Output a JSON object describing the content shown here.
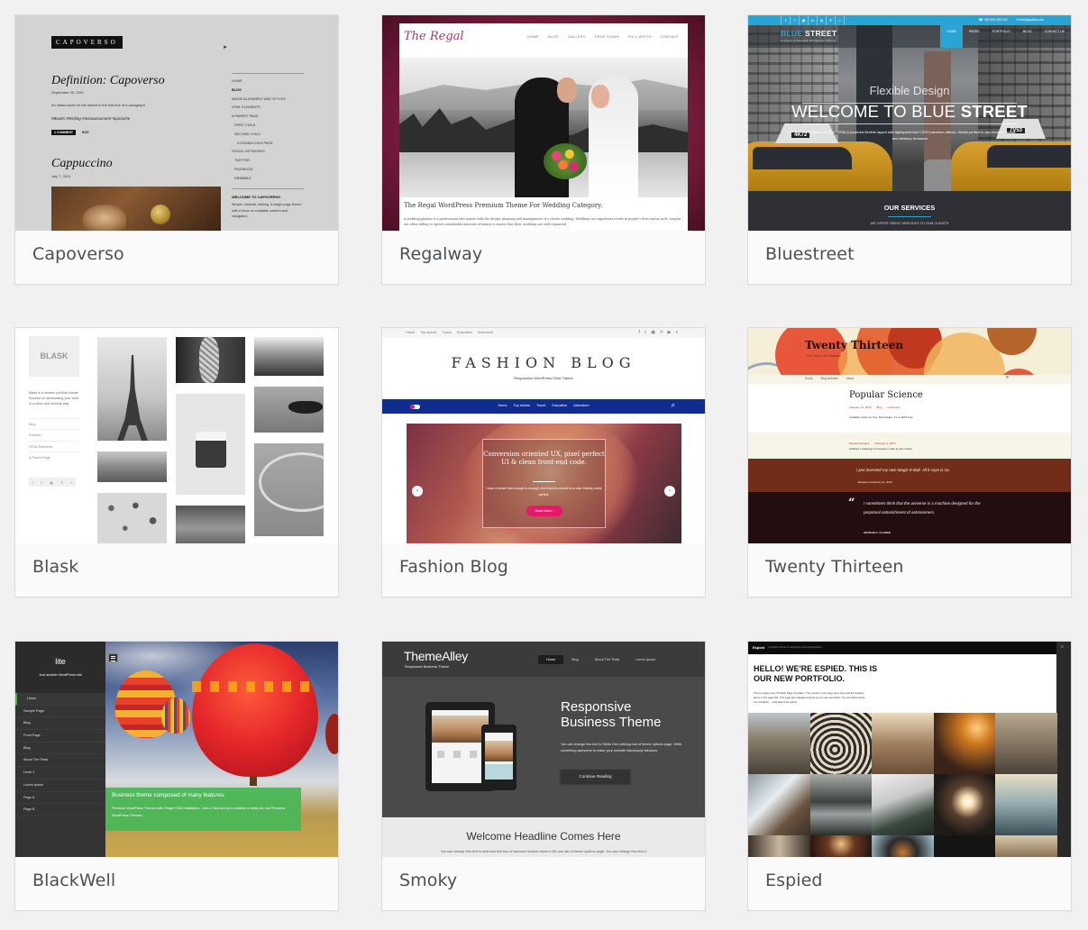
{
  "page": {
    "background": "#f1f1f1"
  },
  "themes": [
    {
      "name": "Capoverso",
      "preview": {
        "logo": "CAPOVERSO",
        "post1_title": "Definition: Capoverso",
        "post1_date": "September 20, 2011",
        "post1_text": "An Italian word for the indent in the first line of a paragraph.",
        "post1_tags": "#Books  #Writing  #announcement  #panache",
        "post1_comment_button": "1 COMMENT",
        "post1_edit": "EDIT",
        "post2_title": "Cappuccino",
        "post2_date": "July 7, 2011",
        "sidebar_menu": [
          "HOME",
          "BLOG",
          "IMAGE ALIGNMENT AND STYLES",
          "HTML ELEMENTS",
          "A PARENT PAGE",
          "FIRST CHILD",
          "SECOND CHILD",
          "A GRANDCHILD PAGE",
          "SOCIAL NETWORKS",
          "TWITTER",
          "FACEBOOK",
          "DRIBBBLE"
        ],
        "widget_title": "WELCOME TO CAPOVERSO",
        "widget_text": "Simple, minimal, striking. A single-page theme with a focus on readable content and navigation."
      }
    },
    {
      "name": "Regalway",
      "preview": {
        "logo": "The Regal",
        "nav": [
          "HOME",
          "BLOG",
          "GALLERY",
          "DROP DOWN",
          "FULL WIDTH",
          "CONTACT"
        ],
        "headline": "The Regal WordPress Premium Theme For Wedding Category.",
        "body": "A wedding planner is a professional who assists with the design, planning and management of a clients wedding. Weddings are significant events in people's lives and as such, couples are often willing to spend considerable amounts of money to ensure that their weddings are well-organized.",
        "accent_color": "#7a1c40"
      }
    },
    {
      "name": "Bluestreet",
      "preview": {
        "social_icons": [
          "twitter-icon",
          "facebook-icon",
          "instagram-icon",
          "linkedin-icon",
          "dribbble-icon",
          "pinterest-icon",
          "rss-icon"
        ],
        "phone": "+48 000 456 120",
        "email": "info@quality.com",
        "logo_part1": "BLUE",
        "logo_part2": "STREET",
        "logo_tagline": "Creative & Flexible Wordpress Theme",
        "nav": [
          "HOME",
          "PAGES",
          "PORTFOLIO",
          "BLOG",
          "CONTACT US"
        ],
        "hero_subtitle": "Flexible Design",
        "hero_title_light": "WELCOME TO BLUE ",
        "hero_title_bold": "STREET",
        "hero_text": "The state-of-the-art HTML5 powered flexible layout with lightspeed fast CSS3 transition effects. Works perfect in any modern mobile and desktop browsers.",
        "taxi_sign_left": "4K72",
        "taxi_sign_right": "7V53",
        "services_title": "OUR SERVICES",
        "services_text": "WE OFFER GREAT SERVICES TO OUR CLIENTS",
        "accent_color": "#2aa5d3"
      }
    },
    {
      "name": "Blask",
      "preview": {
        "logo": "BLASK",
        "description": "Blask is a modern portfolio theme focused on showcasing your work in a clean and minimal way.",
        "menu": [
          "Blog",
          "Portfolio",
          "HTML Elements",
          "A Parent Page"
        ],
        "social_icons": [
          "facebook-icon",
          "twitter-icon",
          "instagram-icon",
          "pinterest-icon",
          "vimeo-icon"
        ]
      }
    },
    {
      "name": "Fashion Blog",
      "preview": {
        "top_links": [
          "Home",
          "Top stories",
          "Travel",
          "Education",
          "Adventure"
        ],
        "social_icons": [
          "facebook-icon",
          "twitter-icon",
          "instagram-icon",
          "pinterest-icon",
          "youtube-icon",
          "vimeo-icon"
        ],
        "title": "FASHION BLOG",
        "tagline": "Responsive WordPress Child Theme",
        "nav": [
          "Home",
          "Top stories",
          "Travel",
          "Education",
          "Adventure"
        ],
        "slide_title": "Conversion oriented UX, pixel perfect UI & clean front-end code.",
        "slide_text": "I have a dream that enough is enough. And that this should be a user friendly world, perfect.",
        "slide_button": "Read More ›",
        "nav_color": "#0e2d8e",
        "accent_color": "#e6186a"
      }
    },
    {
      "name": "Twenty Thirteen",
      "preview": {
        "title": "Twenty Thirteen",
        "tagline": "The Future is Fantastic",
        "nav": [
          "Home",
          "Blog archives",
          "About"
        ],
        "post_title": "Popular Science",
        "post_meta": [
          "February 12, 2013",
          "Blog",
          "wordpress"
        ],
        "post_text": "Available online for free. But beware, it's a rabbit hole.",
        "aside_meta": [
          "Monsters Engine",
          "February 4, 2013"
        ],
        "aside_text": "Children's drawings of monsters made by box robots.",
        "status_text": "I just invented my own Magic 8-Ball. All it says is no.",
        "status_author": "Benjamin February 11, 2013",
        "quote_text": "I sometimes think that the universe is a machine designed for the perpetual astonishment of astronomers.",
        "quote_author": "ARTHUR C. CLARKE"
      }
    },
    {
      "name": "BlackWell",
      "preview": {
        "site_title": "lite",
        "site_tagline": "Just another WordPress site",
        "menu": [
          "Home",
          "Sample Page",
          "Blog",
          "Front Page",
          "Blog",
          "About The Tests",
          "Level 1",
          "Lorem Ipsum",
          "Page A",
          "Page B"
        ],
        "active_menu_index": 0,
        "banner_title": "Business theme composed of many features.",
        "banner_text": "Premium WordPress Themes with Single Click Installation, Just a Click and your website is ready for use Premium WordPress Themes.",
        "accent_color": "#4caf50"
      }
    },
    {
      "name": "Smoky",
      "preview": {
        "logo": "ThemeAlley",
        "tagline": "Responsive Business Theme",
        "nav": [
          "Home",
          "Blog",
          "About The Tests",
          "Lorem Ipsum"
        ],
        "active_nav_index": 0,
        "hero_title": "Responsive Business Theme",
        "hero_text": "You can change this text in Slider One settings tab of theme options page. Write something awesome to make your website ridiculously fabulous.",
        "hero_button": "Continue Reading",
        "welcome_title": "Welcome Headline Comes Here",
        "welcome_text": "You can change this text in welcome text box of welcome section block in Biz one tab of theme options page. You can change this text in"
      }
    },
    {
      "name": "Espied",
      "preview": {
        "site_title": "Espied",
        "site_tagline": "A portfolio theme for designers and photographers",
        "headline": "HELLO! WE'RE ESPIED. THIS IS OUR NEW PORTFOLIO.",
        "text": "This is a page uses \"Portfolio Page Template.\" The content on the page goes here and the heading above is the page title. This page also displays projects as you can see below. You can add projects from Portfolio → Add New in the admin."
      }
    }
  ]
}
